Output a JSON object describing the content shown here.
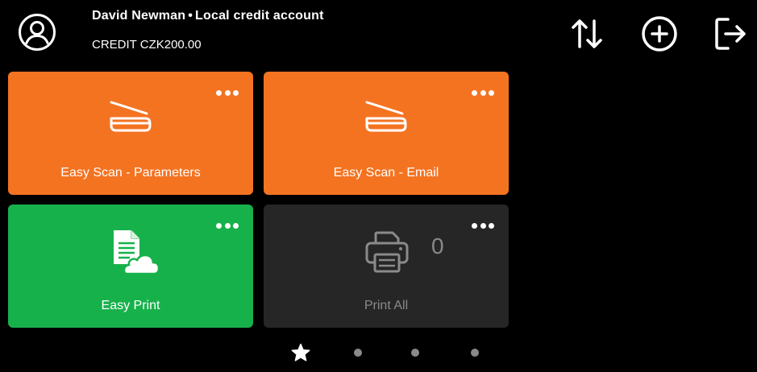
{
  "header": {
    "user_name": "David Newman",
    "separator": "•",
    "account_type": "Local credit account",
    "credit_label": "CREDIT",
    "credit_value": "CZK200.00",
    "icons": {
      "avatar": "user-circle-icon",
      "swap": "swap-arrows-icon",
      "add": "plus-circle-icon",
      "logout": "logout-icon"
    }
  },
  "tiles": [
    {
      "label": "Easy Scan - Parameters",
      "color": "#F47321",
      "icon": "scanner-icon"
    },
    {
      "label": "Easy Scan - Email",
      "color": "#F47321",
      "icon": "scanner-icon"
    },
    {
      "label": "Easy Print",
      "color": "#17B14B",
      "icon": "document-cloud-icon"
    },
    {
      "label": "Print All",
      "color": "#262626",
      "icon": "printer-icon",
      "count": "0"
    }
  ],
  "pager": {
    "pages": 4,
    "current": 0,
    "first_icon": "star-icon"
  }
}
